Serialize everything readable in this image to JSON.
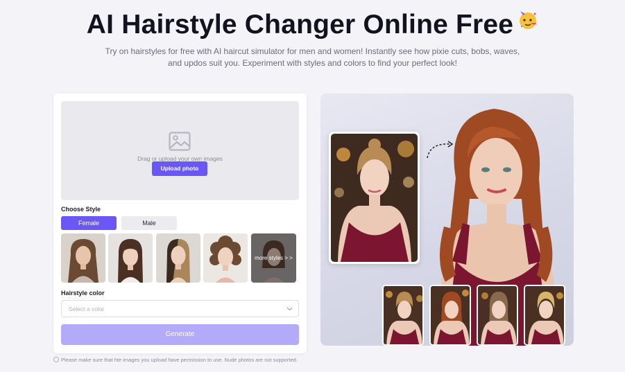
{
  "hero": {
    "title": "AI Hairstyle Changer Online Free",
    "emoji_icon": "party-face-icon",
    "subtitle": "Try on hairstyles for free with AI haircut simulator for men and women! Instantly see how pixie cuts, bobs, waves, and updos suit you. Experiment with styles and colors to find your perfect look!"
  },
  "upload": {
    "icon": "image-icon",
    "hint": "Drag or upload your own images",
    "button_label": "Upload photo"
  },
  "style": {
    "label": "Choose Style",
    "tabs": [
      {
        "label": "Female",
        "active": true
      },
      {
        "label": "Male",
        "active": false
      }
    ],
    "more_label": "more styles > >"
  },
  "color": {
    "label": "Hairstyle color",
    "placeholder": "Select a color"
  },
  "generate_label": "Generate",
  "disclaimer": "Please make sure that hte images you upload have permission to use. Nude photos are not supported.",
  "colors": {
    "accent": "#6b57f5",
    "accent_disabled": "#b3abf9",
    "background": "#f4f4f8"
  }
}
